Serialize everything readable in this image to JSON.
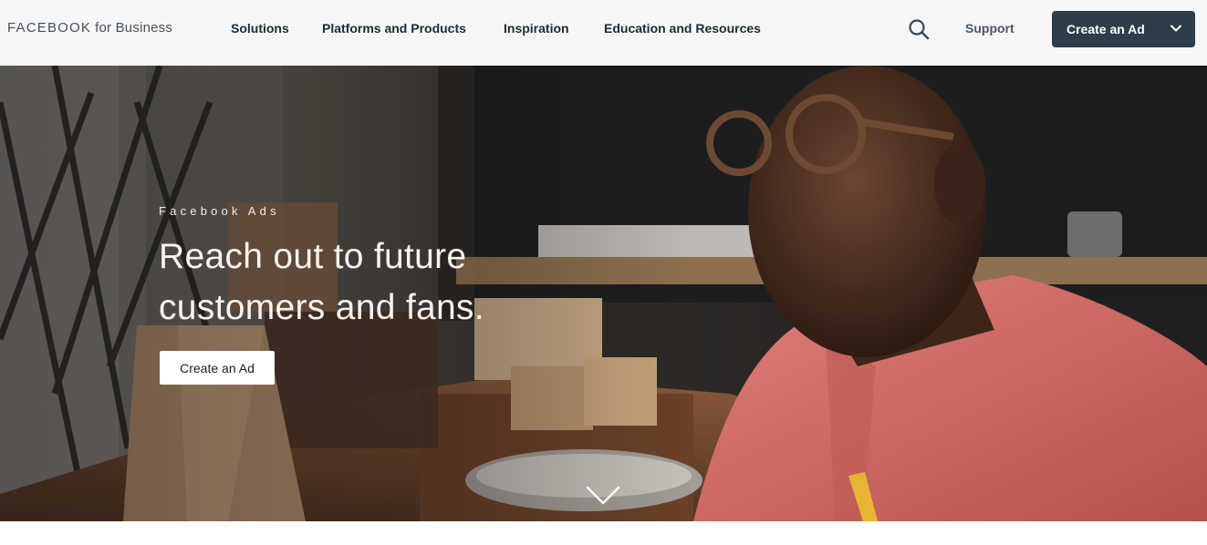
{
  "header": {
    "brand_strong": "FACEBOOK",
    "brand_light": "for Business",
    "nav": [
      {
        "label": "Solutions"
      },
      {
        "label": "Platforms and Products"
      },
      {
        "label": "Inspiration"
      },
      {
        "label": "Education and Resources"
      }
    ],
    "search_icon": "search-icon",
    "support_label": "Support",
    "cta_label": "Create an Ad",
    "cta_icon": "chevron-down-icon"
  },
  "hero": {
    "eyebrow": "Facebook Ads",
    "headline_line1": "Reach out to future",
    "headline_line2": "customers and fans.",
    "button_label": "Create an Ad",
    "scroll_icon": "chevron-down-icon"
  },
  "colors": {
    "header_bg": "#f5f6f7",
    "cta_bg": "#2d3e4a",
    "text_dark": "#1c2b33",
    "hero_text": "#f7f3ee"
  }
}
